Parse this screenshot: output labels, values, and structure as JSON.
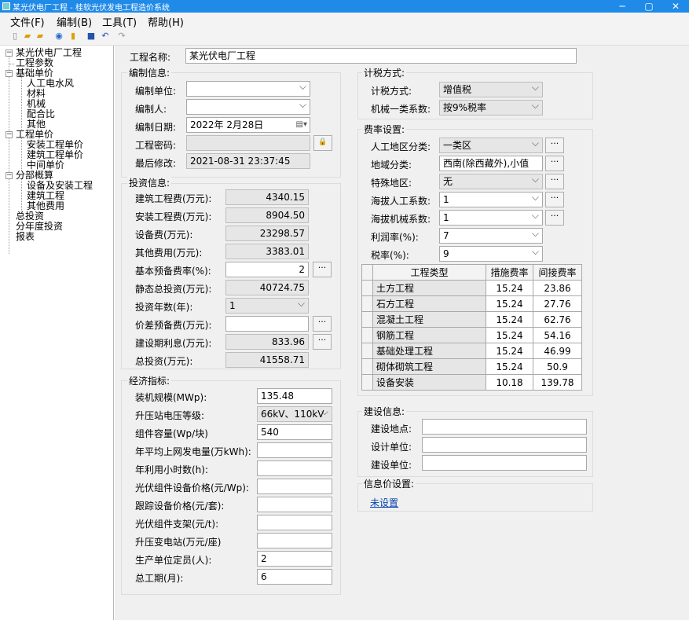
{
  "window": {
    "title": "某光伏电厂工程 - 桂软光伏发电工程造价系统",
    "minimize": "─",
    "maximize": "▢",
    "close": "✕"
  },
  "menu": [
    "文件(F)",
    "编制(B)",
    "工具(T)",
    "帮助(H)"
  ],
  "tree": {
    "root": "某光伏电厂工程",
    "project_params": "工程参数",
    "basic_price": "基础单价",
    "labor": "人工电水风",
    "material": "材料",
    "machine": "机械",
    "mix": "配合比",
    "other": "其他",
    "unit_price": "工程单价",
    "install_price": "安装工程单价",
    "build_price": "建筑工程单价",
    "mid_price": "中间单价",
    "estimate": "分部概算",
    "equip_install": "设备及安装工程",
    "build_eng": "建筑工程",
    "other_fee": "其他费用",
    "total_invest": "总投资",
    "yearly_invest": "分年度投资",
    "report": "报表"
  },
  "project": {
    "name_label": "工程名称:",
    "name": "某光伏电厂工程"
  },
  "compile": {
    "title": "编制信息:",
    "unit_label": "编制单位:",
    "unit": "",
    "person_label": "编制人:",
    "person": "",
    "date_label": "编制日期:",
    "date": "2022年 2月28日",
    "password_label": "工程密码:",
    "password": "",
    "modified_label": "最后修改:",
    "modified": "2021-08-31 23:37:45"
  },
  "invest": {
    "title": "投资信息:",
    "build_label": "建筑工程费(万元):",
    "build": "4340.15",
    "install_label": "安装工程费(万元):",
    "install": "8904.50",
    "equip_label": "设备费(万元):",
    "equip": "23298.57",
    "other_label": "其他费用(万元):",
    "other": "3383.01",
    "basic_rate_label": "基本预备费率(%):",
    "basic_rate": "2",
    "static_label": "静态总投资(万元):",
    "static": "40724.75",
    "years_label": "投资年数(年):",
    "years": "1",
    "price_diff_label": "价差预备费(万元):",
    "price_diff": "",
    "interest_label": "建设期利息(万元):",
    "interest": "833.96",
    "total_label": "总投资(万元):",
    "total": "41558.71"
  },
  "econ": {
    "title": "经济指标:",
    "scale_label": "装机规模(MWp):",
    "scale": "135.48",
    "voltage_label": "升压站电压等级:",
    "voltage": "66kV、110kV",
    "module_label": "组件容量(Wp/块)",
    "module": "540",
    "annual_label": "年平均上网发电量(万kWh):",
    "annual": "",
    "hours_label": "年利用小时数(h):",
    "hours": "",
    "pv_price_label": "光伏组件设备价格(元/Wp):",
    "pv_price": "",
    "tracker_label": "跟踪设备价格(元/套):",
    "tracker": "",
    "bracket_label": "光伏组件支架(元/t):",
    "bracket": "",
    "booster_label": "升压变电站(万元/座)",
    "booster": "",
    "staff_label": "生产单位定员(人):",
    "staff": "2",
    "period_label": "总工期(月):",
    "period": "6"
  },
  "tax": {
    "title": "计税方式:",
    "method_label": "计税方式:",
    "method": "增值税",
    "coef_label": "机械一类系数:",
    "coef": "按9%税率"
  },
  "rate": {
    "title": "费率设置:",
    "labor_area_label": "人工地区分类:",
    "labor_area": "一类区",
    "region_label": "地域分类:",
    "region": "西南(除西藏外),小值",
    "special_label": "特殊地区:",
    "special": "无",
    "alt_labor_label": "海拔人工系数:",
    "alt_labor": "1",
    "alt_mach_label": "海拔机械系数:",
    "alt_mach": "1",
    "profit_label": "利润率(%):",
    "profit": "7",
    "taxrate_label": "税率(%):",
    "taxrate": "9",
    "columns": [
      "工程类型",
      "措施费率",
      "间接费率"
    ],
    "rows": [
      [
        "土方工程",
        "15.24",
        "23.86"
      ],
      [
        "石方工程",
        "15.24",
        "27.76"
      ],
      [
        "混凝土工程",
        "15.24",
        "62.76"
      ],
      [
        "钢筋工程",
        "15.24",
        "54.16"
      ],
      [
        "基础处理工程",
        "15.24",
        "46.99"
      ],
      [
        "砌体砌筑工程",
        "15.24",
        "50.9"
      ],
      [
        "设备安装",
        "10.18",
        "139.78"
      ]
    ]
  },
  "build_info": {
    "title": "建设信息:",
    "site_label": "建设地点:",
    "site": "",
    "design_label": "设计单位:",
    "design": "",
    "builder_label": "建设单位:",
    "builder": ""
  },
  "price_info": {
    "title": "信息价设置:",
    "link": "未设置"
  },
  "icons": {
    "ellipsis": "···",
    "lock": "🔒",
    "calendar": "▤▾"
  },
  "colors": {
    "titlebar": "#1f8ae8",
    "panel": "#f0f0f0",
    "link": "#0645ad"
  }
}
